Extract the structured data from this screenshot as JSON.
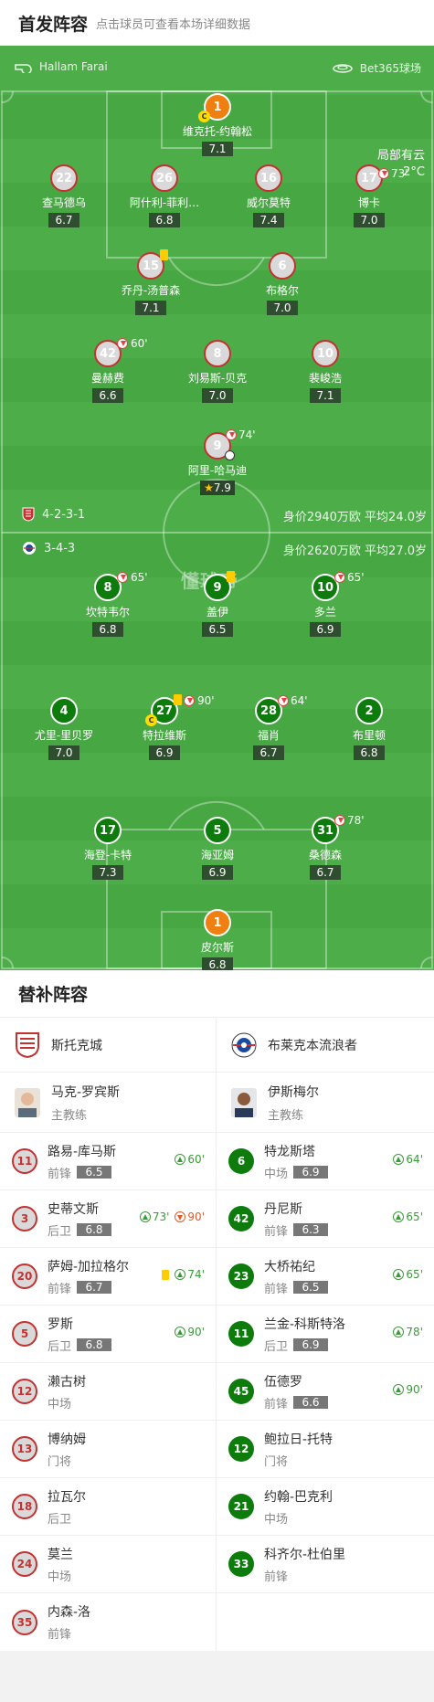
{
  "header": {
    "title": "首发阵容",
    "subtitle": "点击球员可查看本场详细数据"
  },
  "match": {
    "referee": "Hallam Farai",
    "venue": "Bet365球场",
    "weather": "局部有云",
    "temp": "2°C"
  },
  "home_team": {
    "name": "斯托克城",
    "formation": "4-2-3-1",
    "value": "身价2940万欧 平均24.0岁",
    "color": "#c43131"
  },
  "away_team": {
    "name": "布莱克本流浪者",
    "formation": "3-4-3",
    "value": "身价2620万欧 平均27.0岁",
    "color": "#0d7c0d"
  },
  "watermark": "懂球帝",
  "home_players": [
    {
      "num": "1",
      "name": "维克托-约翰松",
      "rating": "7.1"
    },
    {
      "num": "22",
      "name": "查马德乌",
      "rating": "6.7"
    },
    {
      "num": "26",
      "name": "阿什利-菲利…",
      "rating": "6.8"
    },
    {
      "num": "16",
      "name": "威尔莫特",
      "rating": "7.4"
    },
    {
      "num": "17",
      "name": "博卡",
      "rating": "7.0",
      "sub": "73'"
    },
    {
      "num": "15",
      "name": "乔丹-汤普森",
      "rating": "7.1"
    },
    {
      "num": "6",
      "name": "布格尔",
      "rating": "7.0"
    },
    {
      "num": "42",
      "name": "曼赫费",
      "rating": "6.6",
      "sub": "60'"
    },
    {
      "num": "8",
      "name": "刘易斯-贝克",
      "rating": "7.0"
    },
    {
      "num": "10",
      "name": "裴峻浩",
      "rating": "7.1"
    },
    {
      "num": "9",
      "name": "阿里-哈马迪",
      "rating": "7.9",
      "sub": "74'"
    }
  ],
  "away_players": [
    {
      "num": "8",
      "name": "坎特韦尔",
      "rating": "6.8",
      "sub": "65'"
    },
    {
      "num": "9",
      "name": "盖伊",
      "rating": "6.5"
    },
    {
      "num": "10",
      "name": "多兰",
      "rating": "6.9",
      "sub": "65'"
    },
    {
      "num": "4",
      "name": "尤里-里贝罗",
      "rating": "7.0"
    },
    {
      "num": "27",
      "name": "特拉维斯",
      "rating": "6.9",
      "sub": "90'"
    },
    {
      "num": "28",
      "name": "福肖",
      "rating": "6.7",
      "sub": "64'"
    },
    {
      "num": "2",
      "name": "布里顿",
      "rating": "6.8"
    },
    {
      "num": "17",
      "name": "海登-卡特",
      "rating": "7.3"
    },
    {
      "num": "5",
      "name": "海亚姆",
      "rating": "6.9"
    },
    {
      "num": "31",
      "name": "桑德森",
      "rating": "6.7",
      "sub": "78'"
    },
    {
      "num": "1",
      "name": "皮尔斯",
      "rating": "6.8"
    }
  ],
  "subs": {
    "title": "替补阵容",
    "home_coach": {
      "name": "马克-罗宾斯",
      "role": "主教练"
    },
    "away_coach": {
      "name": "伊斯梅尔",
      "role": "主教练"
    },
    "home": [
      {
        "num": "11",
        "name": "路易-库马斯",
        "pos": "前锋",
        "rating": "6.5",
        "in": "60'"
      },
      {
        "num": "3",
        "name": "史蒂文斯",
        "pos": "后卫",
        "rating": "6.8",
        "in": "73'",
        "out": "90'"
      },
      {
        "num": "20",
        "name": "萨姆-加拉格尔",
        "pos": "前锋",
        "rating": "6.7",
        "in": "74'"
      },
      {
        "num": "5",
        "name": "罗斯",
        "pos": "后卫",
        "rating": "6.8",
        "in": "90'"
      },
      {
        "num": "12",
        "name": "濑古树",
        "pos": "中场"
      },
      {
        "num": "13",
        "name": "博纳姆",
        "pos": "门将"
      },
      {
        "num": "18",
        "name": "拉瓦尔",
        "pos": "后卫"
      },
      {
        "num": "24",
        "name": "莫兰",
        "pos": "中场"
      },
      {
        "num": "35",
        "name": "内森-洛",
        "pos": "前锋"
      }
    ],
    "away": [
      {
        "num": "6",
        "name": "特龙斯塔",
        "pos": "中场",
        "rating": "6.9",
        "in": "64'"
      },
      {
        "num": "42",
        "name": "丹尼斯",
        "pos": "前锋",
        "rating": "6.3",
        "in": "65'"
      },
      {
        "num": "23",
        "name": "大桥祐纪",
        "pos": "前锋",
        "rating": "6.5",
        "in": "65'"
      },
      {
        "num": "11",
        "name": "兰金-科斯特洛",
        "pos": "后卫",
        "rating": "6.9",
        "in": "78'"
      },
      {
        "num": "45",
        "name": "伍德罗",
        "pos": "前锋",
        "rating": "6.6",
        "in": "90'"
      },
      {
        "num": "12",
        "name": "鲍拉日-托特",
        "pos": "门将"
      },
      {
        "num": "21",
        "name": "约翰-巴克利",
        "pos": "中场"
      },
      {
        "num": "33",
        "name": "科齐尔-杜伯里",
        "pos": "前锋"
      }
    ]
  }
}
